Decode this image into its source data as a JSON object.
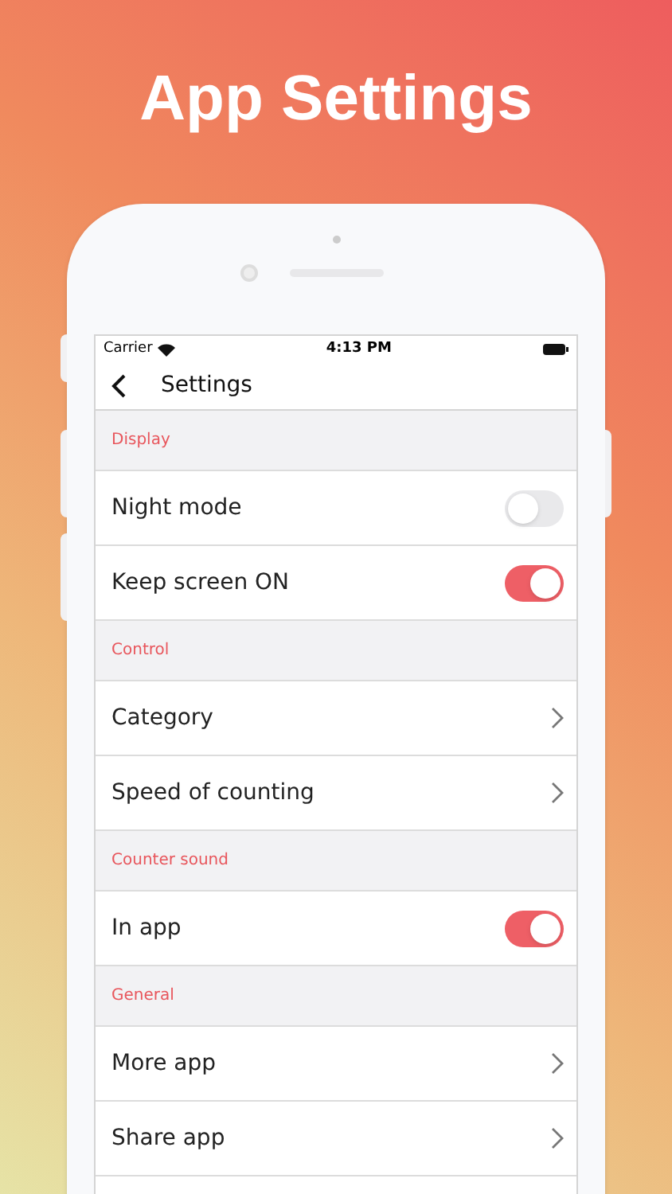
{
  "headline": "App Settings",
  "status_bar": {
    "carrier": "Carrier",
    "time": "4:13 PM"
  },
  "nav": {
    "title": "Settings"
  },
  "sections": [
    {
      "header": "Display",
      "items": [
        {
          "label": "Night mode",
          "kind": "toggle",
          "on": false
        },
        {
          "label": "Keep screen ON",
          "kind": "toggle",
          "on": true
        }
      ]
    },
    {
      "header": "Control",
      "items": [
        {
          "label": "Category",
          "kind": "link"
        },
        {
          "label": "Speed of counting",
          "kind": "link"
        }
      ]
    },
    {
      "header": "Counter sound",
      "items": [
        {
          "label": "In app",
          "kind": "toggle",
          "on": true
        }
      ]
    },
    {
      "header": "General",
      "items": [
        {
          "label": "More app",
          "kind": "link"
        },
        {
          "label": "Share app",
          "kind": "link"
        }
      ]
    }
  ]
}
